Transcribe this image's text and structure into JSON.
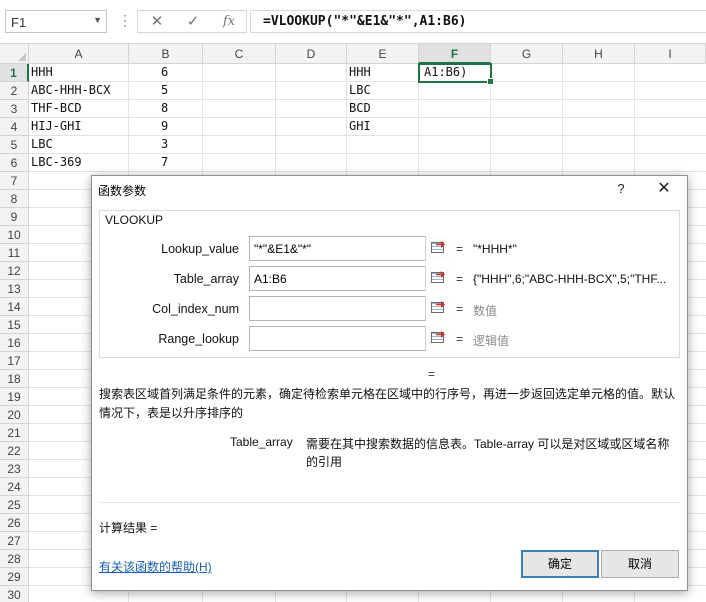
{
  "formula_bar": {
    "name_box": "F1",
    "cancel_glyph": "✕",
    "enter_glyph": "✓",
    "fx_label": "fx",
    "formula": "=VLOOKUP(\"*\"&E1&\"*\",A1:B6)"
  },
  "sheet": {
    "columns": [
      "A",
      "B",
      "C",
      "D",
      "E",
      "F",
      "G",
      "H",
      "I"
    ],
    "active_column": "F",
    "rows": [
      "1",
      "2",
      "3",
      "4",
      "5",
      "6",
      "7",
      "8",
      "9",
      "10",
      "11",
      "12",
      "13",
      "14",
      "15",
      "16",
      "17",
      "18",
      "19",
      "20",
      "21",
      "22",
      "23",
      "24",
      "25",
      "26",
      "27",
      "28",
      "29",
      "30"
    ],
    "active_row": "1",
    "col_a": [
      "HHH",
      "ABC-HHH-BCX",
      "THF-BCD",
      "HIJ-GHI",
      "LBC",
      "LBC-369"
    ],
    "col_b": [
      "6",
      "5",
      "8",
      "9",
      "3",
      "7"
    ],
    "col_e": [
      "HHH",
      "LBC",
      "BCD",
      "GHI"
    ],
    "f1_edit": "A1:B6)"
  },
  "dialog": {
    "title": "函数参数",
    "help_glyph": "?",
    "close_glyph": "✕",
    "function_name": "VLOOKUP",
    "args": [
      {
        "label": "Lookup_value",
        "value": "\"*\"&E1&\"*\"",
        "result": "\"*HHH*\"",
        "result_gray": false
      },
      {
        "label": "Table_array",
        "value": "A1:B6",
        "result": "{\"HHH\",6;\"ABC-HHH-BCX\",5;\"THF...",
        "result_gray": false
      },
      {
        "label": "Col_index_num",
        "value": "",
        "result": "数值",
        "result_gray": true
      },
      {
        "label": "Range_lookup",
        "value": "",
        "result": "逻辑值",
        "result_gray": true
      }
    ],
    "equals": "=",
    "function_equals": "=",
    "description": "搜索表区域首列满足条件的元素，确定待检索单元格在区域中的行序号，再进一步返回选定单元格的值。默认情况下，表是以升序排序的",
    "arg_desc_name": "Table_array",
    "arg_desc_text": "需要在其中搜索数据的信息表。Table-array 可以是对区域或区域名称的引用",
    "calc_result": "计算结果 =",
    "help_link": "有关该函数的帮助(H)",
    "ok_label": "确定",
    "cancel_label": "取消"
  },
  "colors": {
    "excel_green": "#217346",
    "link_blue": "#1a5fb4",
    "ok_border": "#3c7fb1"
  }
}
